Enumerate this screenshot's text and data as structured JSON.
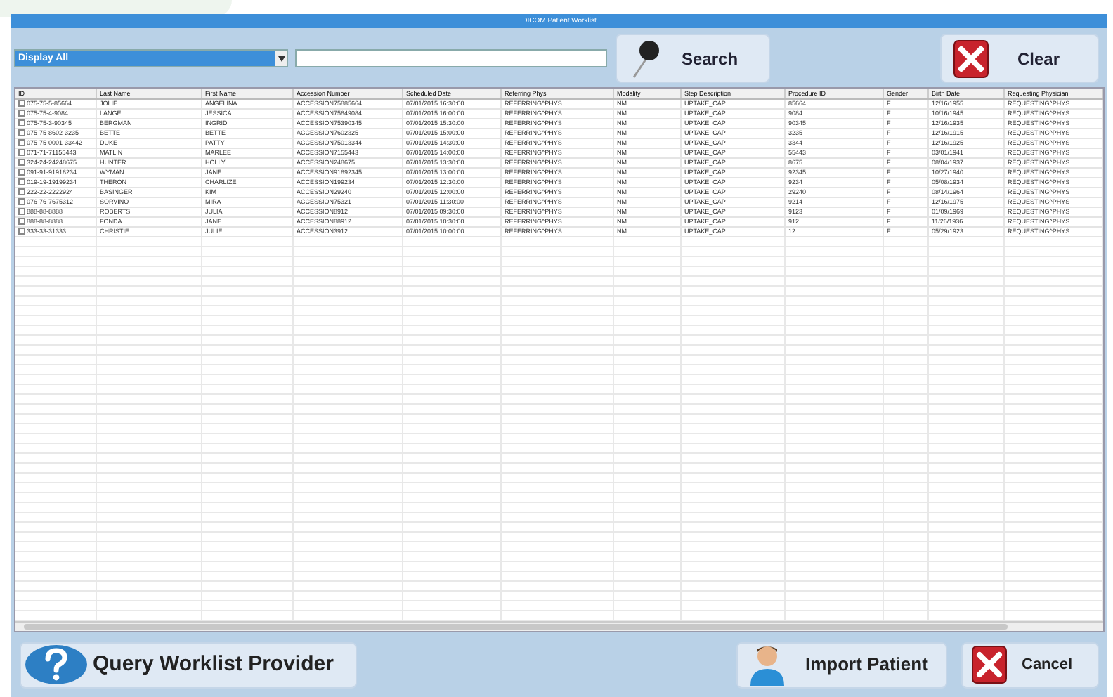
{
  "window": {
    "title": "DICOM Patient Worklist"
  },
  "filter": {
    "value": "Display All"
  },
  "search_button": "Search",
  "clear_button": "Clear",
  "table": {
    "columns": [
      "ID",
      "Last Name",
      "First Name",
      "Accession Number",
      "Scheduled Date",
      "Referring Phys",
      "Modality",
      "Step Description",
      "Procedure ID",
      "Gender",
      "Birth Date",
      "Requesting Physician"
    ],
    "rows": [
      {
        "checked": false,
        "cells": [
          "075-75-5-85664",
          "JOLIE",
          "ANGELINA",
          "ACCESSION75885664",
          "07/01/2015 16:30:00",
          "REFERRING^PHYS",
          "NM",
          "UPTAKE_CAP",
          "85664",
          "F",
          "12/16/1955",
          "REQUESTING^PHYS"
        ]
      },
      {
        "checked": false,
        "cells": [
          "075-75-4-9084",
          "LANGE",
          "JESSICA",
          "ACCESSION75849084",
          "07/01/2015 16:00:00",
          "REFERRING^PHYS",
          "NM",
          "UPTAKE_CAP",
          "9084",
          "F",
          "10/16/1945",
          "REQUESTING^PHYS"
        ]
      },
      {
        "checked": false,
        "cells": [
          "075-75-3-90345",
          "BERGMAN",
          "INGRID",
          "ACCESSION75390345",
          "07/01/2015 15:30:00",
          "REFERRING^PHYS",
          "NM",
          "UPTAKE_CAP",
          "90345",
          "F",
          "12/16/1935",
          "REQUESTING^PHYS"
        ]
      },
      {
        "checked": false,
        "cells": [
          "075-75-8602-3235",
          "BETTE",
          "BETTE",
          "ACCESSION7602325",
          "07/01/2015 15:00:00",
          "REFERRING^PHYS",
          "NM",
          "UPTAKE_CAP",
          "3235",
          "F",
          "12/16/1915",
          "REQUESTING^PHYS"
        ]
      },
      {
        "checked": false,
        "cells": [
          "075-75-0001-33442",
          "DUKE",
          "PATTY",
          "ACCESSION75013344",
          "07/01/2015 14:30:00",
          "REFERRING^PHYS",
          "NM",
          "UPTAKE_CAP",
          "3344",
          "F",
          "12/16/1925",
          "REQUESTING^PHYS"
        ]
      },
      {
        "checked": false,
        "cells": [
          "071-71-71155443",
          "MATLIN",
          "MARLEE",
          "ACCESSION7155443",
          "07/01/2015 14:00:00",
          "REFERRING^PHYS",
          "NM",
          "UPTAKE_CAP",
          "55443",
          "F",
          "03/01/1941",
          "REQUESTING^PHYS"
        ]
      },
      {
        "checked": false,
        "cells": [
          "324-24-24248675",
          "HUNTER",
          "HOLLY",
          "ACCESSION248675",
          "07/01/2015 13:30:00",
          "REFERRING^PHYS",
          "NM",
          "UPTAKE_CAP",
          "8675",
          "F",
          "08/04/1937",
          "REQUESTING^PHYS"
        ]
      },
      {
        "checked": false,
        "cells": [
          "091-91-91918234",
          "WYMAN",
          "JANE",
          "ACCESSION91892345",
          "07/01/2015 13:00:00",
          "REFERRING^PHYS",
          "NM",
          "UPTAKE_CAP",
          "92345",
          "F",
          "10/27/1940",
          "REQUESTING^PHYS"
        ]
      },
      {
        "checked": false,
        "cells": [
          "019-19-19199234",
          "THERON",
          "CHARLIZE",
          "ACCESSION199234",
          "07/01/2015 12:30:00",
          "REFERRING^PHYS",
          "NM",
          "UPTAKE_CAP",
          "9234",
          "F",
          "05/08/1934",
          "REQUESTING^PHYS"
        ]
      },
      {
        "checked": false,
        "cells": [
          "222-22-2222924",
          "BASINGER",
          "KIM",
          "ACCESSION29240",
          "07/01/2015 12:00:00",
          "REFERRING^PHYS",
          "NM",
          "UPTAKE_CAP",
          "29240",
          "F",
          "08/14/1964",
          "REQUESTING^PHYS"
        ]
      },
      {
        "checked": false,
        "cells": [
          "076-76-7675312",
          "SORVINO",
          "MIRA",
          "ACCESSION75321",
          "07/01/2015 11:30:00",
          "REFERRING^PHYS",
          "NM",
          "UPTAKE_CAP",
          "9214",
          "F",
          "12/16/1975",
          "REQUESTING^PHYS"
        ]
      },
      {
        "checked": false,
        "cells": [
          "888-88-8888",
          "ROBERTS",
          "JULIA",
          "ACCESSION8912",
          "07/01/2015 09:30:00",
          "REFERRING^PHYS",
          "NM",
          "UPTAKE_CAP",
          "9123",
          "F",
          "01/09/1969",
          "REQUESTING^PHYS"
        ]
      },
      {
        "checked": false,
        "cells": [
          "888-88-8888",
          "FONDA",
          "JANE",
          "ACCESSION88912",
          "07/01/2015 10:30:00",
          "REFERRING^PHYS",
          "NM",
          "UPTAKE_CAP",
          "912",
          "F",
          "11/26/1936",
          "REQUESTING^PHYS"
        ]
      },
      {
        "checked": false,
        "cells": [
          "333-33-31333",
          "CHRISTIE",
          "JULIE",
          "ACCESSION3912",
          "07/01/2015 10:00:00",
          "REFERRING^PHYS",
          "NM",
          "UPTAKE_CAP",
          "12",
          "F",
          "05/29/1923",
          "REQUESTING^PHYS"
        ]
      }
    ]
  },
  "query_button": "Query Worklist Provider",
  "import_button": "Import Patient",
  "cancel_button": "Cancel"
}
